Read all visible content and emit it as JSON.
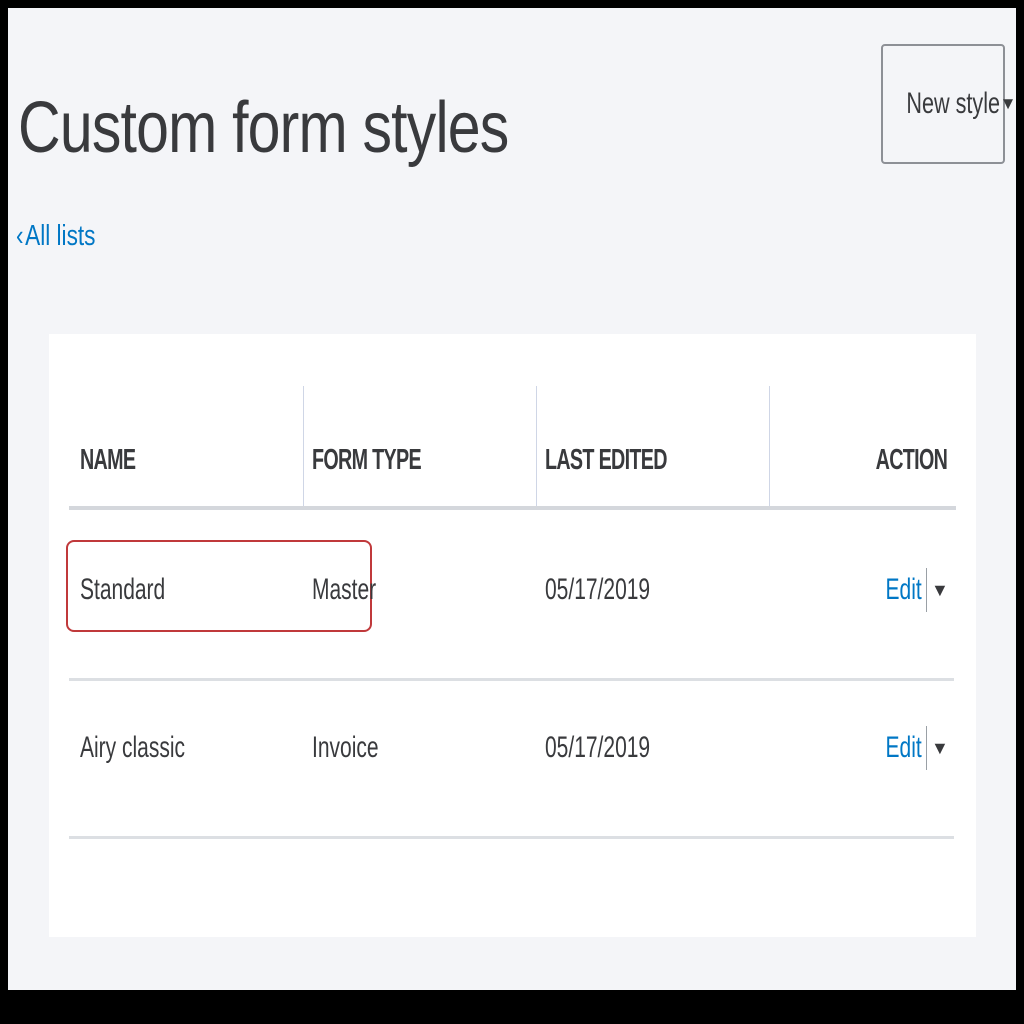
{
  "header": {
    "title": "Custom form styles",
    "back_link": "All lists",
    "back_chevron": "‹",
    "new_style_button": "New style",
    "dropdown_caret": "▼"
  },
  "table": {
    "columns": {
      "name": "NAME",
      "form_type": "FORM TYPE",
      "last_edited": "LAST EDITED",
      "action": "ACTION"
    },
    "rows": [
      {
        "name": "Standard",
        "form_type": "Master",
        "last_edited": "05/17/2019",
        "action": "Edit",
        "highlighted": true
      },
      {
        "name": "Airy classic",
        "form_type": "Invoice",
        "last_edited": "05/17/2019",
        "action": "Edit",
        "highlighted": false
      }
    ]
  },
  "colors": {
    "accent": "#0077c5",
    "highlight_border": "#c0393b",
    "text": "#393a3d",
    "background": "#f4f5f8"
  }
}
